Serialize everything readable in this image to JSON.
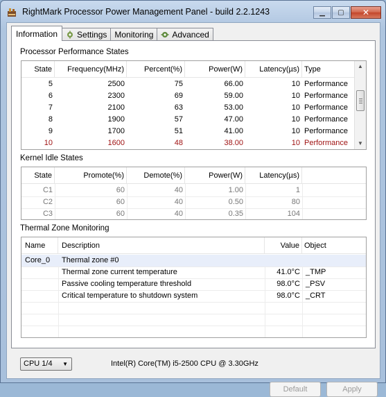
{
  "window": {
    "title": "RightMark Processor Power Management Panel - build 2.2.1243",
    "minimize_glyph": "▁",
    "maximize_glyph": "▢",
    "close_glyph": "✕"
  },
  "tabs": [
    {
      "label": "Information",
      "icon": ""
    },
    {
      "label": "Settings",
      "icon": "settings-icon"
    },
    {
      "label": "Monitoring",
      "icon": ""
    },
    {
      "label": "Advanced",
      "icon": "advanced-icon"
    }
  ],
  "perf": {
    "title": "Processor Performance States",
    "headers": [
      "State",
      "Frequency(MHz)",
      "Percent(%)",
      "Power(W)",
      "Latency(µs)",
      "Type"
    ],
    "rows": [
      {
        "state": "5",
        "freq": "2500",
        "percent": "75",
        "power": "66.00",
        "latency": "10",
        "type": "Performance",
        "current": false
      },
      {
        "state": "6",
        "freq": "2300",
        "percent": "69",
        "power": "59.00",
        "latency": "10",
        "type": "Performance",
        "current": false
      },
      {
        "state": "7",
        "freq": "2100",
        "percent": "63",
        "power": "53.00",
        "latency": "10",
        "type": "Performance",
        "current": false
      },
      {
        "state": "8",
        "freq": "1900",
        "percent": "57",
        "power": "47.00",
        "latency": "10",
        "type": "Performance",
        "current": false
      },
      {
        "state": "9",
        "freq": "1700",
        "percent": "51",
        "power": "41.00",
        "latency": "10",
        "type": "Performance",
        "current": false
      },
      {
        "state": "10",
        "freq": "1600",
        "percent": "48",
        "power": "38.00",
        "latency": "10",
        "type": "Performance",
        "current": true
      }
    ]
  },
  "idle": {
    "title": "Kernel Idle States",
    "headers": [
      "State",
      "Promote(%)",
      "Demote(%)",
      "Power(W)",
      "Latency(µs)"
    ],
    "rows": [
      {
        "state": "C1",
        "promote": "60",
        "demote": "40",
        "power": "1.00",
        "latency": "1"
      },
      {
        "state": "C2",
        "promote": "60",
        "demote": "40",
        "power": "0.50",
        "latency": "80"
      },
      {
        "state": "C3",
        "promote": "60",
        "demote": "40",
        "power": "0.35",
        "latency": "104"
      }
    ]
  },
  "thermal": {
    "title": "Thermal Zone Monitoring",
    "headers": [
      "Name",
      "Description",
      "Value",
      "Object"
    ],
    "zone": {
      "name": "Core_0",
      "description": "Thermal zone #0"
    },
    "rows": [
      {
        "description": "Thermal zone current temperature",
        "value": "41.0°C",
        "object": "_TMP"
      },
      {
        "description": "Passive cooling temperature threshold",
        "value": "98.0°C",
        "object": "_PSV"
      },
      {
        "description": "Critical temperature to shutdown system",
        "value": "98.0°C",
        "object": "_CRT"
      }
    ]
  },
  "footer": {
    "cpu_select": "CPU 1/4",
    "cpu_name": "Intel(R) Core(TM) i5-2500 CPU @ 3.30GHz",
    "default_label": "Default",
    "apply_label": "Apply"
  },
  "colors": {
    "current_state": "#a01414",
    "disabled_text": "#9a9a9a"
  }
}
